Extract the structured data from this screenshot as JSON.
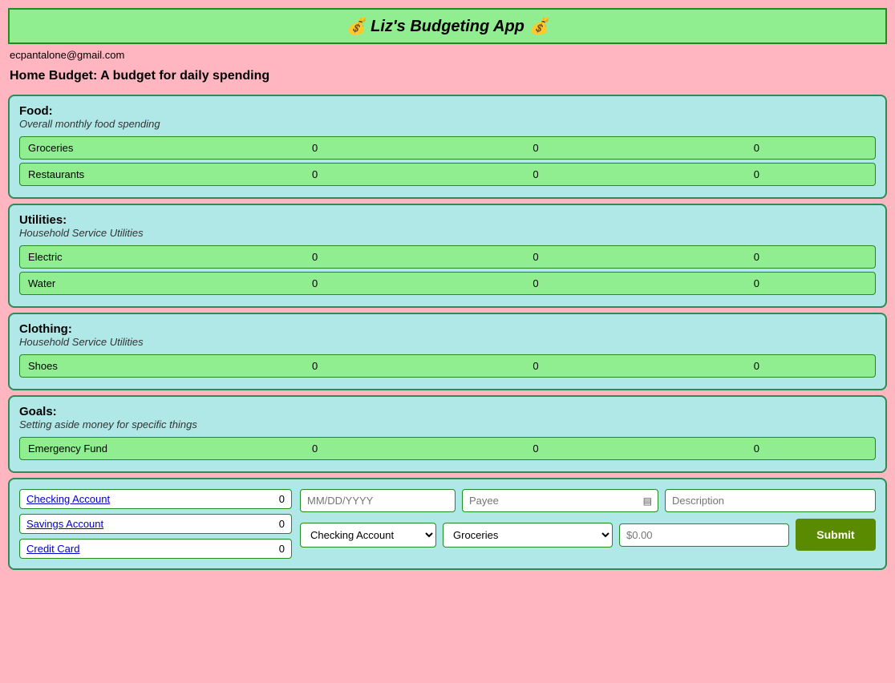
{
  "header": {
    "title": "💰 Liz's Budgeting App 💰"
  },
  "user": {
    "email": "ecpantalone@gmail.com"
  },
  "page_title": "Home Budget: A budget for daily spending",
  "sections": [
    {
      "id": "food",
      "title": "Food:",
      "subtitle": "Overall monthly food spending",
      "rows": [
        {
          "label": "Groceries",
          "val1": "0",
          "val2": "0",
          "val3": "0"
        },
        {
          "label": "Restaurants",
          "val1": "0",
          "val2": "0",
          "val3": "0"
        }
      ]
    },
    {
      "id": "utilities",
      "title": "Utilities:",
      "subtitle": "Household Service Utilities",
      "rows": [
        {
          "label": "Electric",
          "val1": "0",
          "val2": "0",
          "val3": "0"
        },
        {
          "label": "Water",
          "val1": "0",
          "val2": "0",
          "val3": "0"
        }
      ]
    },
    {
      "id": "clothing",
      "title": "Clothing:",
      "subtitle": "Household Service Utilities",
      "rows": [
        {
          "label": "Shoes",
          "val1": "0",
          "val2": "0",
          "val3": "0"
        }
      ]
    },
    {
      "id": "goals",
      "title": "Goals:",
      "subtitle": "Setting aside money for specific things",
      "rows": [
        {
          "label": "Emergency Fund",
          "val1": "0",
          "val2": "0",
          "val3": "0"
        }
      ]
    }
  ],
  "form": {
    "accounts": [
      {
        "label": "Checking Account",
        "value": "0"
      },
      {
        "label": "Savings Account",
        "value": "0"
      },
      {
        "label": "Credit Card",
        "value": "0"
      }
    ],
    "date_placeholder": "MM/DD/YYYY",
    "payee_placeholder": "Payee",
    "description_placeholder": "Description",
    "account_options": [
      "Checking Account",
      "Savings Account",
      "Credit Card"
    ],
    "account_selected": "Checking Account",
    "category_options": [
      "Groceries",
      "Restaurants",
      "Electric",
      "Water",
      "Shoes",
      "Emergency Fund"
    ],
    "category_selected": "Groceries",
    "amount_placeholder": "$0.00",
    "submit_label": "Submit"
  }
}
